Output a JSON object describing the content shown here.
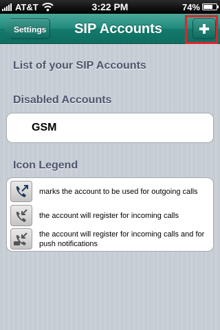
{
  "status_bar": {
    "carrier": "AT&T",
    "time": "3:22 PM",
    "battery_percent": "74%",
    "battery_level": 0.74,
    "icons": [
      "signal-icon",
      "wifi-icon",
      "battery-icon"
    ]
  },
  "nav_bar": {
    "back_label": "Settings",
    "title": "SIP Accounts",
    "add_icon": "plus-icon",
    "highlight_color": "#e0232b"
  },
  "content": {
    "list_header": "List of your SIP Accounts",
    "disabled_header": "Disabled Accounts",
    "accounts": [
      {
        "name": "GSM"
      }
    ],
    "legend_header": "Icon Legend",
    "legend": [
      {
        "icon": "outgoing-call-icon",
        "text": "marks the account to be used for outgoing calls"
      },
      {
        "icon": "incoming-call-icon",
        "text": "the account will register for incoming calls"
      },
      {
        "icon": "push-incoming-call-icon",
        "text": "the account will register for incoming calls and for push notifications"
      }
    ]
  },
  "colors": {
    "nav_bar": "#1f8a7c",
    "background": "#c5ccd4",
    "section_header": "#4c566c"
  }
}
